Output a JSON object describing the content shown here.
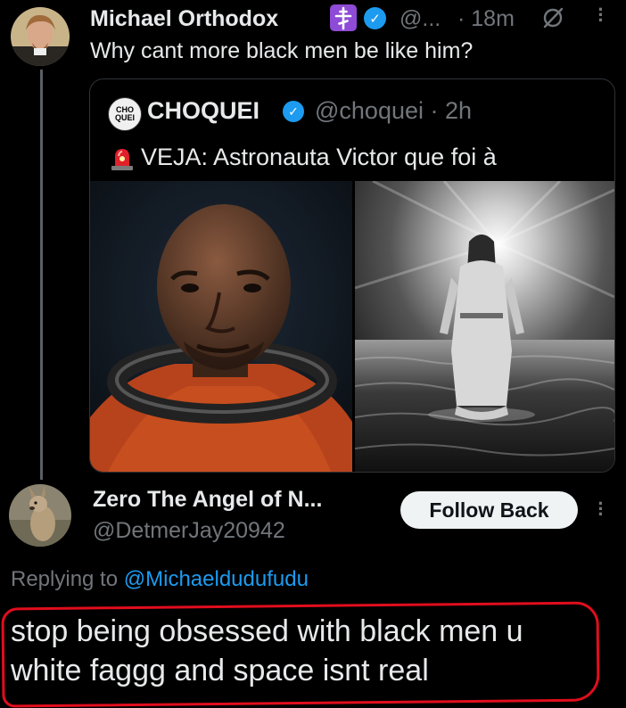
{
  "post": {
    "author_name": "Michael Orthodox",
    "handle_truncated": "@...",
    "time": "· 18m",
    "text": "Why cant more black men be like him?"
  },
  "quote": {
    "author_name": "CHOQUEI",
    "avatar_text": "CHO QUEI",
    "handle_time": "@choquei · 2h",
    "text": "VEJA: Astronauta Victor que foi à",
    "images": [
      "astronaut-portrait",
      "figure-walking-on-sea"
    ]
  },
  "reply": {
    "author_name": "Zero The Angel of N...",
    "handle": "@DetmerJay20942",
    "follow_label": "Follow Back",
    "replying_prefix": "Replying to",
    "replying_handle": "@Michaeldudufudu",
    "text_line1": "stop being obsessed with black men u",
    "text_line2": "white faggg and space isnt real"
  },
  "icons": {
    "verified": "verified-badge-icon",
    "orthodox_cross": "orthodox-cross-icon",
    "grok": "grok-icon",
    "more": "more-options-icon",
    "siren": "siren-emoji-icon"
  },
  "colors": {
    "background": "#000000",
    "text": "#e7e9ea",
    "muted": "#71767b",
    "link": "#1d9bf0",
    "verified": "#1d9bf0",
    "cross_badge": "#8e4bd6",
    "highlight": "#e10d1d"
  }
}
